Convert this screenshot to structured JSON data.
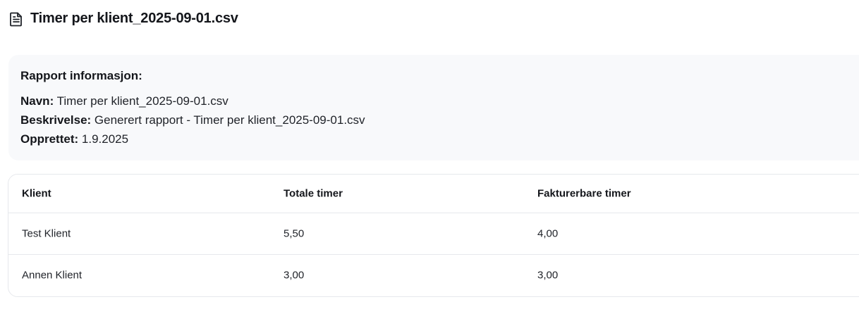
{
  "header": {
    "icon": "document-icon",
    "title": "Timer per klient_2025-09-01.csv"
  },
  "info": {
    "heading": "Rapport informasjon:",
    "name_label": "Navn:",
    "name_value": "Timer per klient_2025-09-01.csv",
    "description_label": "Beskrivelse:",
    "description_value": "Generert rapport - Timer per klient_2025-09-01.csv",
    "created_label": "Opprettet:",
    "created_value": "1.9.2025"
  },
  "table": {
    "columns": [
      "Klient",
      "Totale timer",
      "Fakturerbare timer"
    ],
    "rows": [
      [
        "Test Klient",
        "5,50",
        "4,00"
      ],
      [
        "Annen Klient",
        "3,00",
        "3,00"
      ]
    ]
  }
}
